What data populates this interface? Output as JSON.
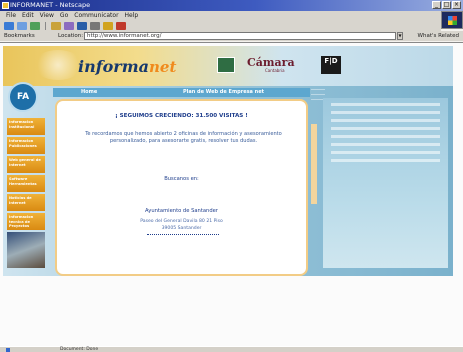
{
  "window": {
    "title": "INFORMANET - Netscape",
    "controls": [
      "_",
      "□",
      "×"
    ]
  },
  "menubar": {
    "items": [
      "File",
      "Edit",
      "View",
      "Go",
      "Communicator",
      "Help"
    ]
  },
  "toolbar": {
    "buttons": [
      "back",
      "forward",
      "reload",
      "home",
      "search",
      "netscape",
      "print",
      "security",
      "stop"
    ]
  },
  "address": {
    "bookmarks_label": "Bookmarks",
    "location_label": "Location:",
    "url": "http://www.informanet.org/",
    "related_label": "What's Related"
  },
  "site": {
    "logo_main": "informa",
    "logo_accent": "net",
    "partner_camara": "Cámara",
    "partner_camara_sub": "Cantabria",
    "partner_fd": "F|D",
    "badge": "FA",
    "nav": [
      "Informacion Institucional",
      "Informacion Publicaciones",
      "Web general de Internet",
      "Software Herramientas",
      "Noticias de Internet",
      "Informacion tecnica de Proyectos"
    ],
    "home_link": "Home",
    "bar_right": "Plan de Web de Empresa net",
    "headline": "¡ SEGUIMOS CRECIENDO: 31.500 VISITAS !",
    "intro": "Te recordamos que hemos abierto 2 oficinas de información y asesoramiento personalizado, para asesorarte gratis, resolver tus dudas.",
    "cta": "Buscanos en:",
    "addr_name": "Ayuntamiento de Santander",
    "addr_street": "Paseo del General Davila 80 21 Piso",
    "addr_city": "39005 Santander"
  },
  "statusbar": {
    "text": "Document: Done"
  }
}
